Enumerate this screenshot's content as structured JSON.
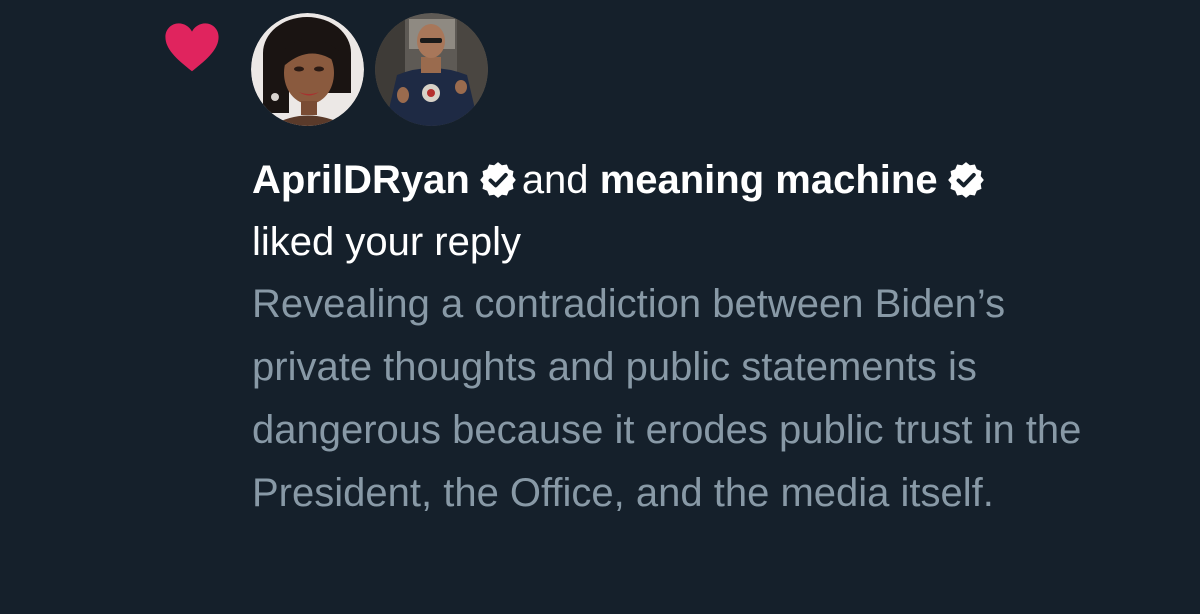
{
  "notification": {
    "type_icon": "heart-icon",
    "like_color": "#e0245e",
    "users": [
      {
        "name": "AprilDRyan",
        "verified": true,
        "avatar_icon": "avatar-april-d-ryan"
      },
      {
        "name": "meaning machine",
        "verified": true,
        "avatar_icon": "avatar-meaning-machine"
      }
    ],
    "connector": "and",
    "action": "liked your reply",
    "reply_text": "Revealing a contradiction between Biden’s private thoughts and public statements is dangerous because it erodes public trust in the President, the Office, and the media itself."
  },
  "colors": {
    "background": "#15202b",
    "primary_text": "#ffffff",
    "secondary_text": "#8899a6"
  }
}
